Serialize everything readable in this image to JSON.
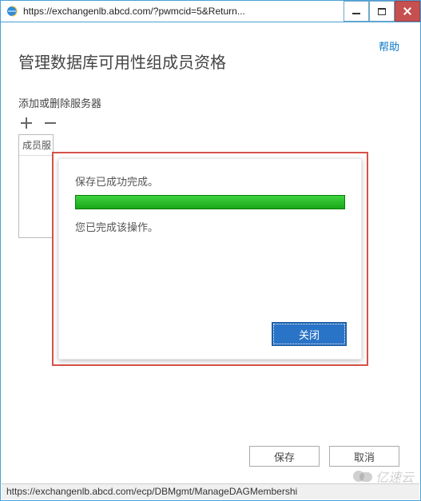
{
  "window": {
    "url": "https://exchangenlb.abcd.com/?pwmcid=5&Return..."
  },
  "header": {
    "help": "帮助",
    "title": "管理数据库可用性组成员资格"
  },
  "servers": {
    "section_label": "添加或删除服务器",
    "column_header": "成员服"
  },
  "dialog": {
    "message": "保存已成功完成。",
    "sub_message": "您已完成该操作。",
    "close_label": "关闭"
  },
  "footer": {
    "save": "保存",
    "cancel": "取消"
  },
  "status_url": "https://exchangenlb.abcd.com/ecp/DBMgmt/ManageDAGMembershi",
  "watermark": "亿速云"
}
